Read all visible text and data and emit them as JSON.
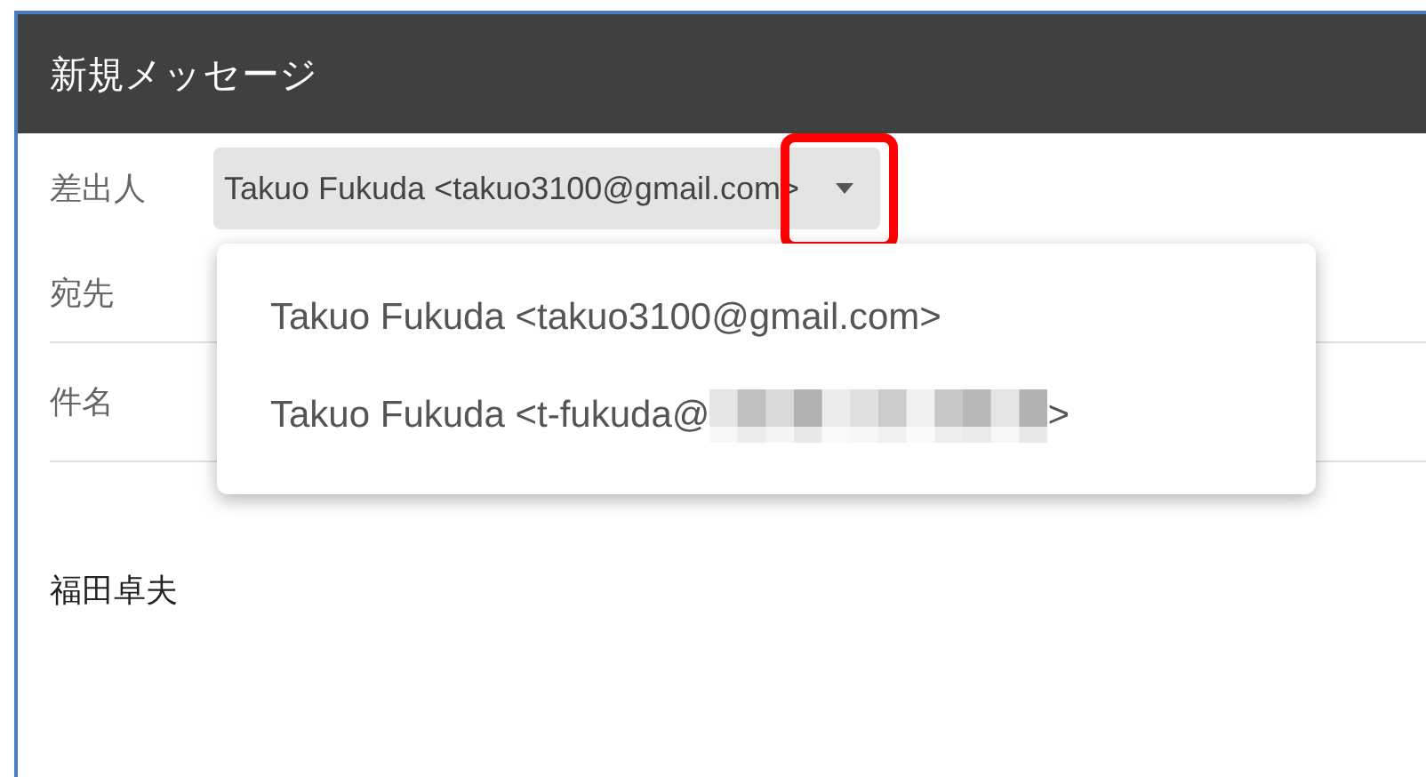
{
  "window": {
    "title": "新規メッセージ"
  },
  "from": {
    "label": "差出人",
    "value": "Takuo Fukuda <takuo3100@gmail.com>",
    "arrow_highlighted": true,
    "options": [
      {
        "text": "Takuo Fukuda <takuo3100@gmail.com>",
        "redacted": false
      },
      {
        "text": "Takuo Fukuda <t-fukuda@",
        "redacted": true,
        "text_after": ">"
      }
    ]
  },
  "to": {
    "label": "宛先"
  },
  "subject": {
    "label": "件名"
  },
  "body": {
    "text": "福田卓夫"
  }
}
